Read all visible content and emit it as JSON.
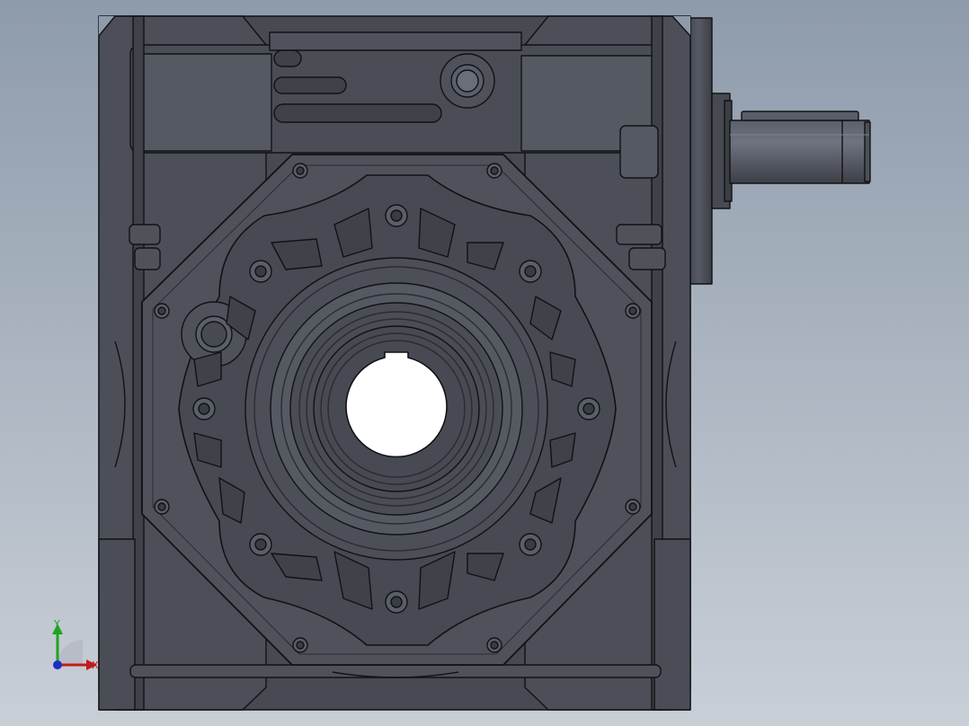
{
  "viewport": {
    "background_top": "#8e9bab",
    "background_bottom": "#c9cfd7",
    "model": "worm-gear-reducer",
    "view": "front"
  },
  "colors": {
    "body": "#4a4d55",
    "body_light": "#5a5e68",
    "body_dark": "#3a3c43",
    "edge": "#111215",
    "highlight": "#7c8290",
    "bore": "#ffffff"
  },
  "triad": {
    "y_label": "Y",
    "x_label": "X",
    "y_color": "#1fa31f",
    "x_color": "#c41a1a",
    "z_color": "#1a2fc4"
  }
}
